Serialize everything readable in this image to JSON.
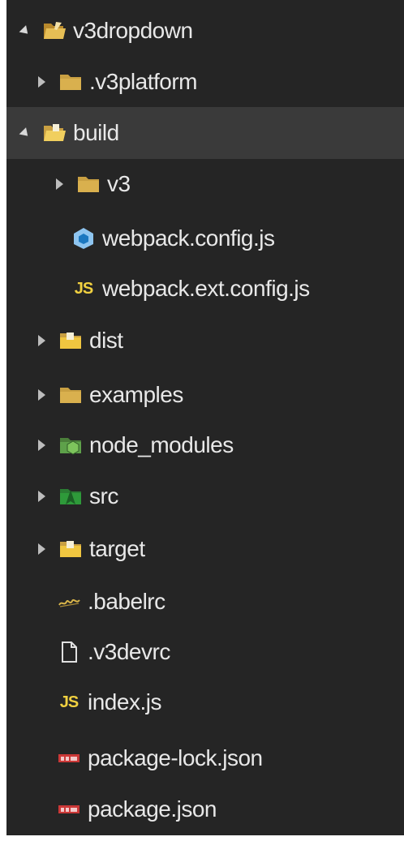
{
  "tree": {
    "root": {
      "label": "v3dropdown",
      "icon": "folder-open-icon",
      "expanded": true
    },
    "items": [
      {
        "label": ".v3platform",
        "icon": "folder-icon",
        "depth": 1,
        "expandable": true,
        "expanded": false
      },
      {
        "label": "build",
        "icon": "folder-open-icon",
        "depth": 1,
        "expandable": true,
        "expanded": true
      },
      {
        "label": "v3",
        "icon": "folder-icon",
        "depth": 2,
        "expandable": true,
        "expanded": false
      },
      {
        "label": "webpack.config.js",
        "icon": "webpack-icon",
        "depth": 2,
        "expandable": false
      },
      {
        "label": "webpack.ext.config.js",
        "icon": "js-icon",
        "glyph": "JS",
        "depth": 2,
        "expandable": false
      },
      {
        "label": "dist",
        "icon": "folder-dist-icon",
        "depth": 1,
        "expandable": true,
        "expanded": false
      },
      {
        "label": "examples",
        "icon": "folder-icon",
        "depth": 1,
        "expandable": true,
        "expanded": false
      },
      {
        "label": "node_modules",
        "icon": "folder-node-icon",
        "depth": 1,
        "expandable": true,
        "expanded": false
      },
      {
        "label": "src",
        "icon": "folder-src-icon",
        "depth": 1,
        "expandable": true,
        "expanded": false
      },
      {
        "label": "target",
        "icon": "folder-dist-icon",
        "depth": 1,
        "expandable": true,
        "expanded": false
      },
      {
        "label": ".babelrc",
        "icon": "babel-icon",
        "depth": 1,
        "expandable": false
      },
      {
        "label": ".v3devrc",
        "icon": "file-icon",
        "depth": 1,
        "expandable": false
      },
      {
        "label": "index.js",
        "icon": "js-icon",
        "glyph": "JS",
        "depth": 1,
        "expandable": false
      },
      {
        "label": "package-lock.json",
        "icon": "npm-icon",
        "depth": 1,
        "expandable": false
      },
      {
        "label": "package.json",
        "icon": "npm-icon",
        "depth": 1,
        "expandable": false
      }
    ]
  },
  "colors": {
    "panel_bg": "#252525",
    "selected_bg": "#3a3a3a",
    "text": "#e8e8e8",
    "folder": "#c9a042",
    "js": "#f0d040",
    "webpack": "#8ec5f0",
    "npm": "#cb3837",
    "node": "#5ea14a",
    "src": "#2e9a3a"
  }
}
